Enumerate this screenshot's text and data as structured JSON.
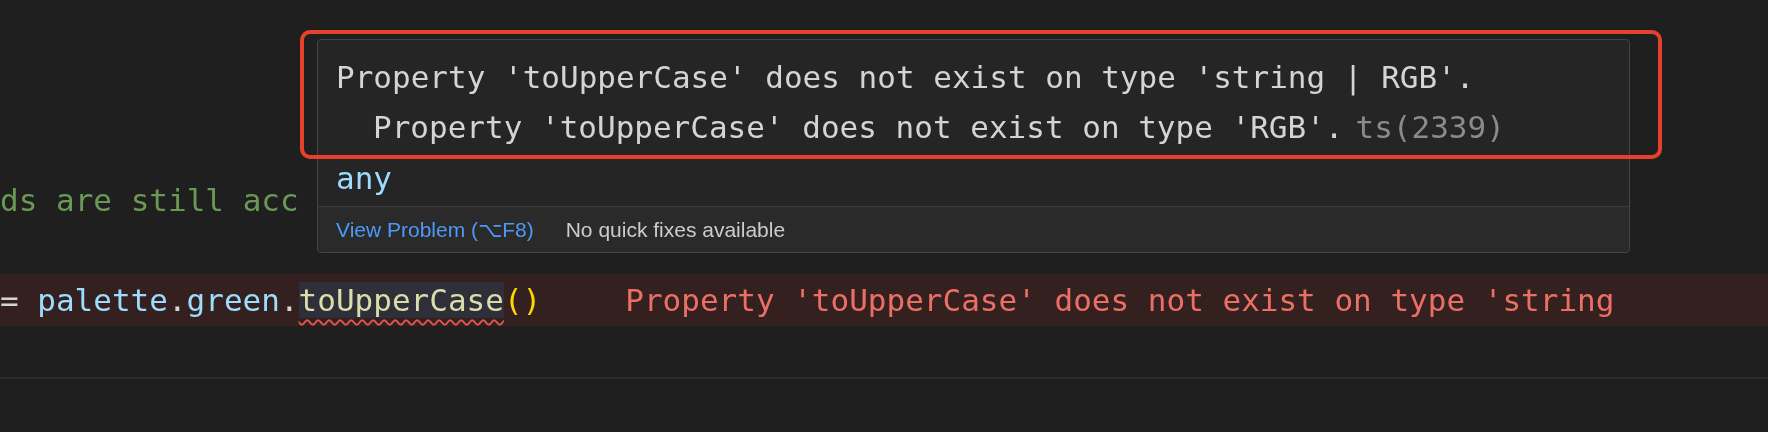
{
  "editor": {
    "lines": [
      {
        "kind": "comment",
        "tokens": [
          {
            "text": "ds are still acc",
            "kind": "comment",
            "error": false
          }
        ]
      },
      {
        "kind": "error",
        "tokens": [
          {
            "text": "=",
            "kind": "operator",
            "error": false
          },
          {
            "text": "palette",
            "kind": "variable",
            "error": false
          },
          {
            "text": ".",
            "kind": "operator",
            "error": false
          },
          {
            "text": "green",
            "kind": "property",
            "error": false
          },
          {
            "text": ".",
            "kind": "operator",
            "error": false
          },
          {
            "text": "toUpperCase",
            "kind": "method",
            "error": true
          },
          {
            "text": "()",
            "kind": "bracket",
            "error": false
          }
        ],
        "inline_error": "Property 'toUpperCase' does not exist on type 'string"
      }
    ]
  },
  "hover": {
    "messages": [
      {
        "text": "Property 'toUpperCase' does not exist on type 'string | RGB'.",
        "children": [
          {
            "text": "Property 'toUpperCase' does not exist on type 'RGB'.",
            "code": "ts(2339)"
          }
        ]
      }
    ],
    "type": "any",
    "action": "View Problem (⌥F8)",
    "status": "No quick fixes available"
  }
}
